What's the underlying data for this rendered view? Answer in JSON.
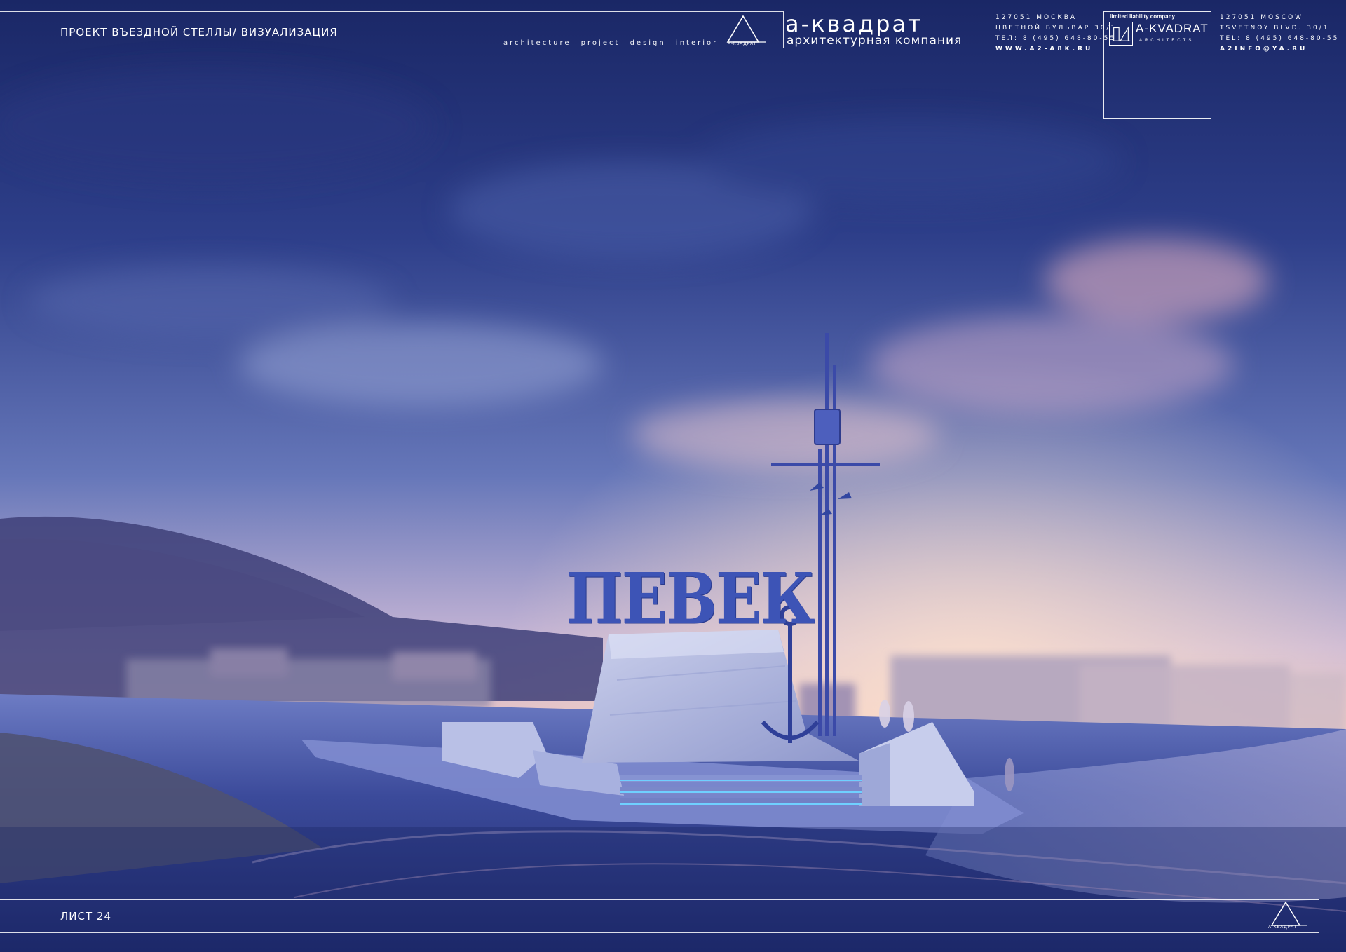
{
  "header": {
    "sheet_title": "ПРОЕКТ ВЪЕЗДНОЙ СТЕЛЛЫ/ ВИЗУАЛИЗАЦИЯ",
    "tagline": "architecture project design interior",
    "logo_caption": "А-КВАДРАТ",
    "company_name": "а-квадрат",
    "company_subtitle": "архитектурная компания",
    "contacts_ru": {
      "line1": "127051 МОСКВА",
      "line2": "ЦВЕТНОЙ БУЛЬВАР 30/1",
      "line3": "ТЕЛ: 8 (495) 648-80-55",
      "web": "WWW.A2-A8K.RU"
    },
    "stamp": {
      "top_text": "limited liability company",
      "name": "A-KVADRAT",
      "sub": "ARCHITECTS"
    },
    "contacts_en": {
      "line1": "127051 MOSCOW",
      "line2": "TSVETNOY BLVD. 30/1",
      "line3": "TEL: 8 (495) 648-80-55",
      "email": "A2INFO@YA.RU"
    }
  },
  "scene": {
    "sign_text": "ПЕВЕК"
  },
  "footer": {
    "sheet_number": "ЛИСТ 24",
    "logo_caption": "А-КВАДРАТ"
  },
  "colors": {
    "sky_top": "#1d2b6e",
    "sky_mid": "#5a6fb2",
    "sky_horizon": "#f3c6bf",
    "ground": "#3a4a95",
    "sign_blue": "#3d54b6",
    "stone": "#b9bfe0",
    "accent_light": "#6fd0ff"
  }
}
